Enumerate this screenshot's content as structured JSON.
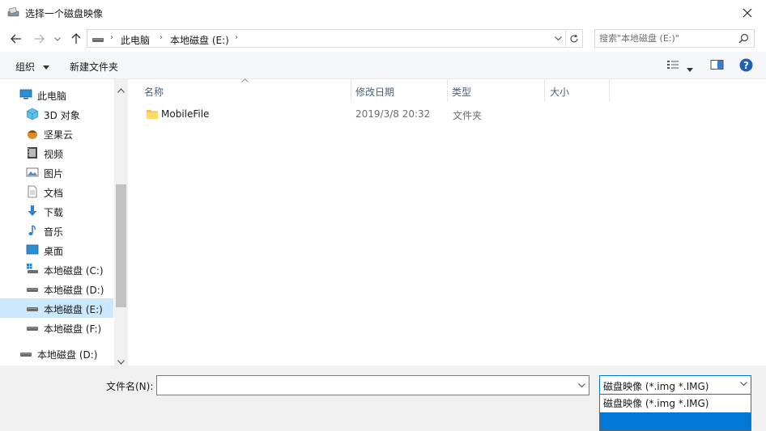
{
  "window": {
    "title": "选择一个磁盘映像"
  },
  "address": {
    "crumbs": [
      "此电脑",
      "本地磁盘 (E:)"
    ],
    "search_placeholder": "搜索\"本地磁盘 (E:)\""
  },
  "toolbar": {
    "organize": "组织",
    "new_folder": "新建文件夹"
  },
  "sidebar": {
    "items": [
      {
        "label": "此电脑",
        "icon": "computer-icon"
      },
      {
        "label": "3D 对象",
        "icon": "cube-icon"
      },
      {
        "label": "坚果云",
        "icon": "nut-icon"
      },
      {
        "label": "视频",
        "icon": "video-icon"
      },
      {
        "label": "图片",
        "icon": "picture-icon"
      },
      {
        "label": "文档",
        "icon": "document-icon"
      },
      {
        "label": "下载",
        "icon": "download-icon"
      },
      {
        "label": "音乐",
        "icon": "music-icon"
      },
      {
        "label": "桌面",
        "icon": "desktop-icon"
      },
      {
        "label": "本地磁盘 (C:)",
        "icon": "drive-icon"
      },
      {
        "label": "本地磁盘 (D:)",
        "icon": "drive-icon"
      },
      {
        "label": "本地磁盘 (E:)",
        "icon": "drive-icon",
        "selected": true
      },
      {
        "label": "本地磁盘 (F:)",
        "icon": "drive-icon"
      },
      {
        "label": "本地磁盘 (D:)",
        "icon": "drive-icon"
      }
    ]
  },
  "file_list": {
    "columns": {
      "name": "名称",
      "modified": "修改日期",
      "type": "类型",
      "size": "大小"
    },
    "rows": [
      {
        "name": "MobileFile",
        "modified": "2019/3/8 20:32",
        "type": "文件夹",
        "size": ""
      }
    ]
  },
  "bottom": {
    "filename_label": "文件名(N):",
    "filename_value": "",
    "filetype_selected": "磁盘映像 (*.img *.IMG)",
    "filetype_options": [
      "磁盘映像 (*.img *.IMG)"
    ]
  },
  "colors": {
    "accent": "#0078d7",
    "selection": "#cce8ff",
    "header_text": "#4c607a"
  }
}
